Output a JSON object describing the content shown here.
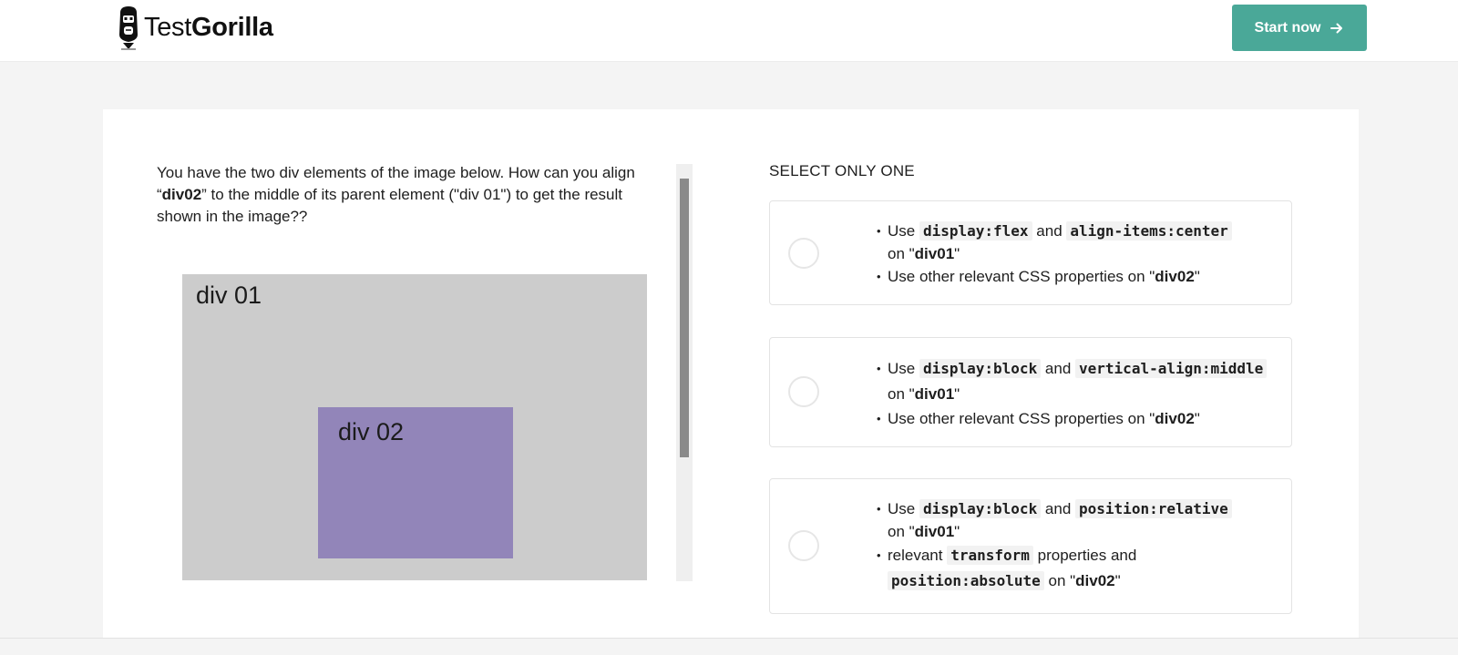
{
  "header": {
    "logo": {
      "brand_light": "Test",
      "brand_bold": "Gorilla",
      "icon": "gorilla-icon"
    },
    "start_button": {
      "label": "Start now",
      "icon": "arrow-right-icon",
      "color": "#4aa898"
    }
  },
  "question": {
    "part1": "You have the two div elements of the image below. How can you align “",
    "bold": "div02",
    "part2": "” to the middle of its parent element (\"div 01\") to get the result shown in the image??"
  },
  "figure": {
    "outer_label": "div 01",
    "inner_label": "div 02",
    "outer_color": "#cccccc",
    "inner_color": "#9285b9"
  },
  "answers": {
    "instruction": "SELECT ONLY ONE",
    "options": [
      {
        "b1_pre": "Use ",
        "b1_code1": "display:flex",
        "b1_mid": " and ",
        "b1_code2": "align-items:center",
        "b1_on": " on \"",
        "b1_target": "div01",
        "b1_close": "\"",
        "b2_text": "Use other relevant CSS properties on \"",
        "b2_target": "div02",
        "b2_close": "\""
      },
      {
        "b1_pre": "Use ",
        "b1_code1": "display:block",
        "b1_mid": " and ",
        "b1_code2": "vertical-align:middle",
        "b1_on": " on \"",
        "b1_target": "div01",
        "b1_close": "\"",
        "b2_text": "Use other relevant CSS properties on \"",
        "b2_target": "div02",
        "b2_close": "\""
      },
      {
        "b1_pre": "Use ",
        "b1_code1": "display:block",
        "b1_mid": " and ",
        "b1_code2": "position:relative",
        "b1_on": " on \"",
        "b1_target": "div01",
        "b1_close": "\"",
        "b2_pre": "relevant ",
        "b2_code1": "transform",
        "b2_mid": " properties and ",
        "b2_code2": "position:absolute",
        "b2_on": " on \"",
        "b2_target": "div02",
        "b2_close": "\""
      }
    ]
  }
}
